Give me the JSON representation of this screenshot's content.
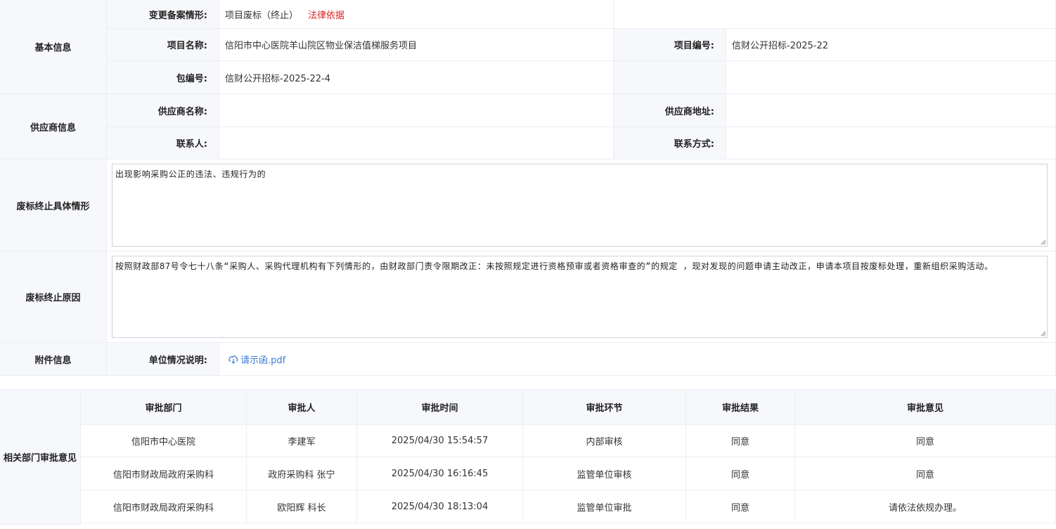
{
  "basic": {
    "section_label": "基本信息",
    "change_label": "变更备案情形:",
    "change_value": "项目废标（终止）",
    "legal_link": "法律依据",
    "project_name_label": "项目名称:",
    "project_name_value": "信阳市中心医院羊山院区物业保洁值梯服务项目",
    "project_no_label": "项目编号:",
    "project_no_value": "信财公开招标-2025-22",
    "package_label": "包编号:",
    "package_value": "信财公开招标-2025-22-4"
  },
  "supplier": {
    "section_label": "供应商信息",
    "name_label": "供应商名称:",
    "name_value": "",
    "address_label": "供应商地址:",
    "address_value": "",
    "contact_label": "联系人:",
    "contact_value": "",
    "phone_label": "联系方式:",
    "phone_value": ""
  },
  "situation": {
    "section_label": "废标终止具体情形",
    "text": "出现影响采购公正的违法、违规行为的"
  },
  "reason": {
    "section_label": "废标终止原因",
    "text": "按照财政部87号令七十八条“采购人、采购代理机构有下列情形的，由财政部门责令限期改正：未按照规定进行资格预审或者资格审查的”的规定 ，现对发现的问题申请主动改正，申请本项目按废标处理，重新组织采购活动。"
  },
  "attachment": {
    "section_label": "附件信息",
    "unit_label": "单位情况说明:",
    "file_name": "请示函.pdf"
  },
  "approval": {
    "section_label": "相关部门审批意见",
    "headers": [
      "审批部门",
      "审批人",
      "审批时间",
      "审批环节",
      "审批结果",
      "审批意见"
    ],
    "rows": [
      [
        "信阳市中心医院",
        "李建军",
        "2025/04/30 15:54:57",
        "内部审核",
        "同意",
        "同意"
      ],
      [
        "信阳市财政局政府采购科",
        "政府采购科 张宁",
        "2025/04/30 16:16:45",
        "监管单位审核",
        "同意",
        "同意"
      ],
      [
        "信阳市财政局政府采购科",
        "欧阳辉 科长",
        "2025/04/30 18:13:04",
        "监管单位审批",
        "同意",
        "请依法依规办理。"
      ]
    ]
  }
}
